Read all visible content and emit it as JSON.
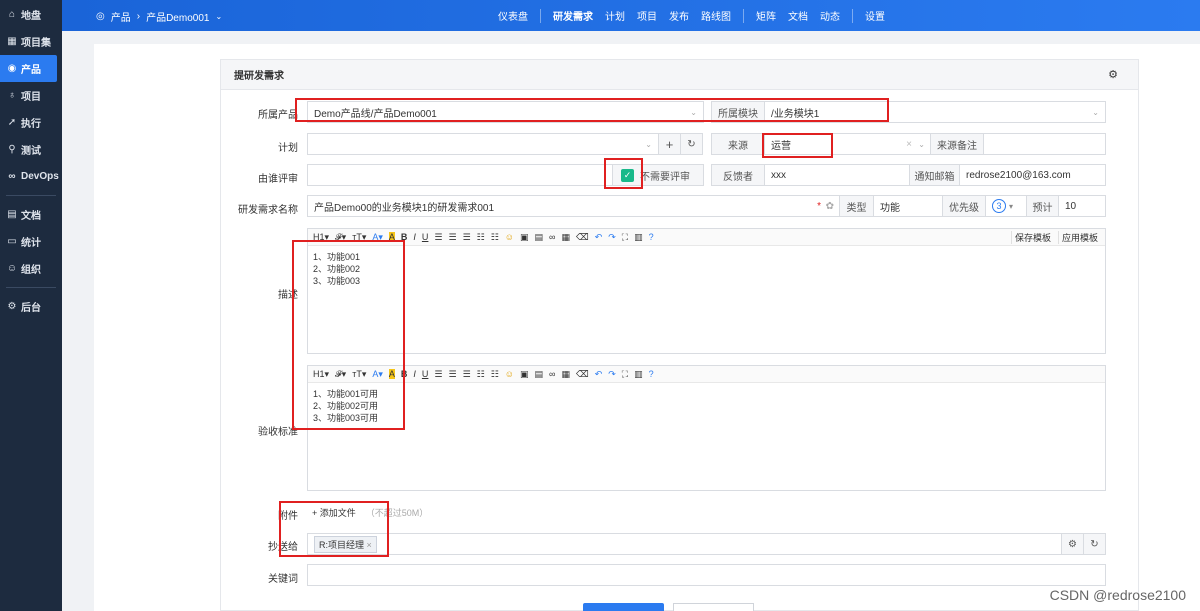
{
  "sidebar": {
    "items": [
      {
        "label": "地盘",
        "icon": "home-icon"
      },
      {
        "label": "项目集",
        "icon": "grid-icon"
      },
      {
        "label": "产品",
        "icon": "location-pin-icon"
      },
      {
        "label": "项目",
        "icon": "bulb-icon"
      },
      {
        "label": "执行",
        "icon": "send-icon"
      },
      {
        "label": "测试",
        "icon": "search-icon"
      },
      {
        "label": "DevOps",
        "icon": "infinity-icon"
      },
      {
        "label": "文档",
        "icon": "document-icon"
      },
      {
        "label": "统计",
        "icon": "chart-icon"
      },
      {
        "label": "组织",
        "icon": "user-icon"
      },
      {
        "label": "后台",
        "icon": "gear-icon"
      }
    ]
  },
  "topbar": {
    "crumb_root": "产品",
    "crumb_product": "产品Demo001",
    "nav": [
      "仪表盘",
      "研发需求",
      "计划",
      "项目",
      "发布",
      "路线图",
      "矩阵",
      "文档",
      "动态",
      "设置"
    ]
  },
  "card": {
    "title": "提研发需求"
  },
  "form": {
    "product_label": "所属产品",
    "product_value": "Demo产品线/产品Demo001",
    "module_label": "所属模块",
    "module_value": "/业务模块1",
    "plan_label": "计划",
    "source_label": "来源",
    "source_value": "运营",
    "source_note_label": "来源备注",
    "review_label": "由谁评审",
    "no_review_label": "不需要评审",
    "feedback_label": "反馈者",
    "feedback_value": "xxx",
    "notify_label": "通知邮箱",
    "notify_value": "redrose2100@163.com",
    "name_label": "研发需求名称",
    "name_value": "产品Demo00的业务模块1的研发需求001",
    "type_label": "类型",
    "type_value": "功能",
    "priority_label": "优先级",
    "priority_value": "3",
    "estimate_label": "预计",
    "estimate_value": "10",
    "desc_label": "描述",
    "desc_lines": [
      "1、功能001",
      "2、功能002",
      "3、功能003"
    ],
    "accept_label": "验收标准",
    "accept_lines": [
      "1、功能001可用",
      "2、功能002可用",
      "3、功能003可用"
    ],
    "save_template": "保存模板",
    "apply_template": "应用模板",
    "attach_label": "附件",
    "add_file": "+ 添加文件",
    "file_limit": "（不超过50M）",
    "cc_label": "抄送给",
    "cc_tag": "R:项目经理",
    "keywords_label": "关键词"
  },
  "toolbar_items": [
    "H1",
    "𝓕",
    "тT",
    "A",
    "A",
    "B",
    "I",
    "U"
  ],
  "watermark": "CSDN @redrose2100"
}
